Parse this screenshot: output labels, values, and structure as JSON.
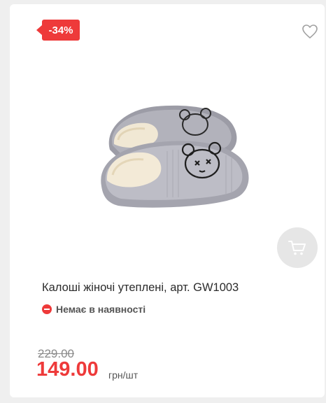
{
  "card": {
    "discount_badge": "-34%",
    "product_title": "Калоші жіночі утеплені, арт. GW1003",
    "stock_status": "Немає в наявності",
    "old_price": "229.00",
    "new_price": "149.00",
    "price_unit": "грн/шт"
  },
  "icons": {
    "favorite": "heart-outline-icon",
    "cart": "cart-icon",
    "stock": "minus-circle-icon"
  },
  "colors": {
    "accent": "#ee3a3a",
    "cart_button_bg": "#e6e6e6",
    "text": "#2b2b2b"
  }
}
